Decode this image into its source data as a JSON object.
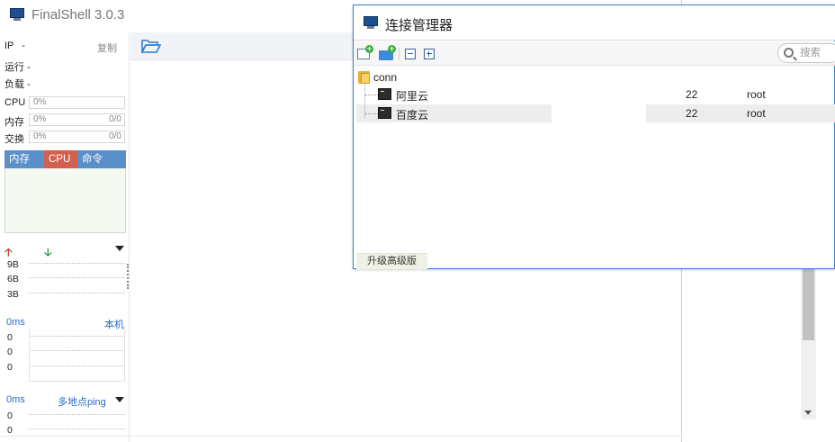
{
  "app": {
    "title": "FinalShell 3.0.3"
  },
  "left_panel": {
    "ip_label": "IP",
    "ip_value": "-",
    "copy_label": "复制",
    "running_label": "运行",
    "running_value": "-",
    "load_label": "负载",
    "load_value": "-",
    "cpu": {
      "label": "CPU",
      "value": "0%"
    },
    "memory": {
      "label": "内存",
      "value": "0%",
      "detail": "0/0"
    },
    "swap": {
      "label": "交换",
      "value": "0%",
      "detail": "0/0"
    },
    "process_tabs": [
      "内存",
      "CPU",
      "命令"
    ],
    "net_axis": [
      "9B",
      "6B",
      "3B"
    ],
    "latency": {
      "value": "0ms",
      "target": "本机",
      "axis": [
        "0",
        "0",
        "0"
      ]
    },
    "ping": {
      "value": "0ms",
      "target": "多地点ping",
      "axis": [
        "0",
        "0"
      ]
    }
  },
  "connection_manager": {
    "title": "连接管理器",
    "search": {
      "placeholder": "搜索"
    },
    "folder": {
      "name": "conn"
    },
    "connections": [
      {
        "name": "阿里云",
        "port": "22",
        "user": "root",
        "selected": false
      },
      {
        "name": "百度云",
        "port": "22",
        "user": "root",
        "selected": true
      }
    ],
    "upgrade_label": "升级高级版"
  },
  "icons": {
    "app": "monitor-icon",
    "open": "folder-open-icon",
    "new_connection": "new-connection-icon",
    "new_folder": "new-folder-icon",
    "collapse": "collapse-all-icon",
    "expand": "expand-all-icon",
    "search": "search-icon",
    "folder": "folder-icon",
    "terminal": "terminal-icon"
  },
  "colors": {
    "accent_blue": "#5b8fc9",
    "cpu_tab": "#d0614e",
    "dialog_border": "#3a7ed3",
    "link_blue": "#2a6ac8"
  }
}
